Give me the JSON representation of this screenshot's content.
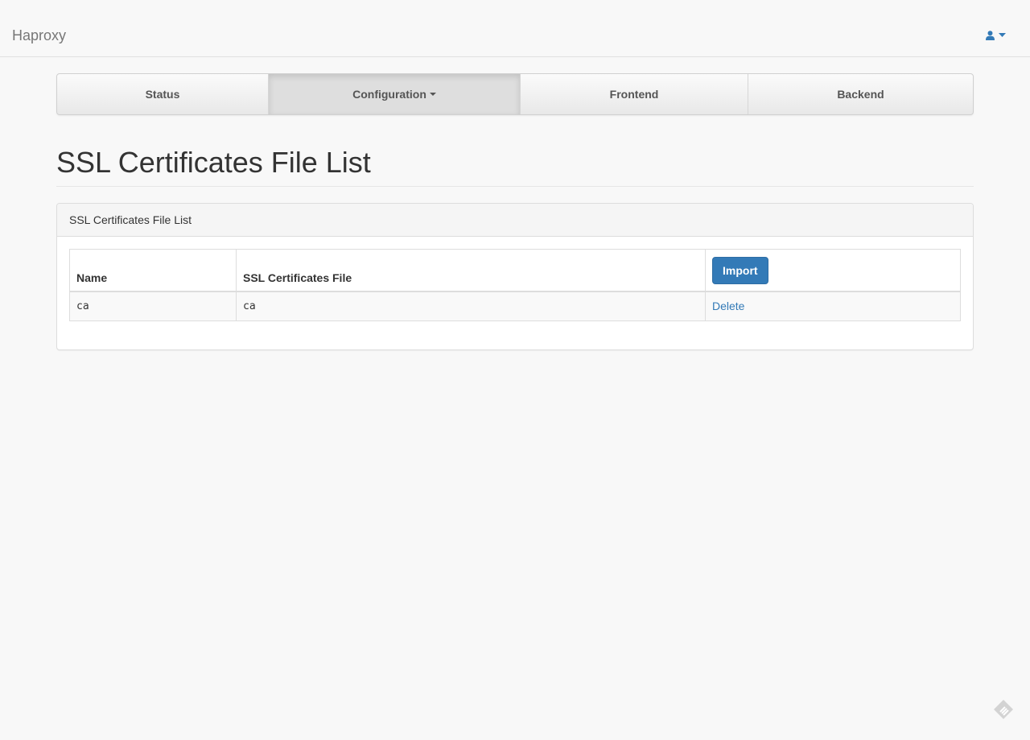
{
  "navbar": {
    "brand": "Haproxy",
    "user_icon": "user-icon",
    "user_caret_icon": "caret-down-icon",
    "accent": "#337ab7"
  },
  "tabs": [
    {
      "label": "Status",
      "active": false
    },
    {
      "label": "Configuration",
      "active": true,
      "dropdown": true
    },
    {
      "label": "Frontend",
      "active": false
    },
    {
      "label": "Backend",
      "active": false
    }
  ],
  "page": {
    "title": "SSL Certificates File List"
  },
  "panel": {
    "heading": "SSL Certificates File List",
    "table": {
      "columns": [
        "Name",
        "SSL Certificates File"
      ],
      "import_label": "Import",
      "rows": [
        {
          "name": "ca",
          "file": "ca",
          "action": "Delete"
        }
      ]
    }
  },
  "corner_icon": "feedback-icon"
}
